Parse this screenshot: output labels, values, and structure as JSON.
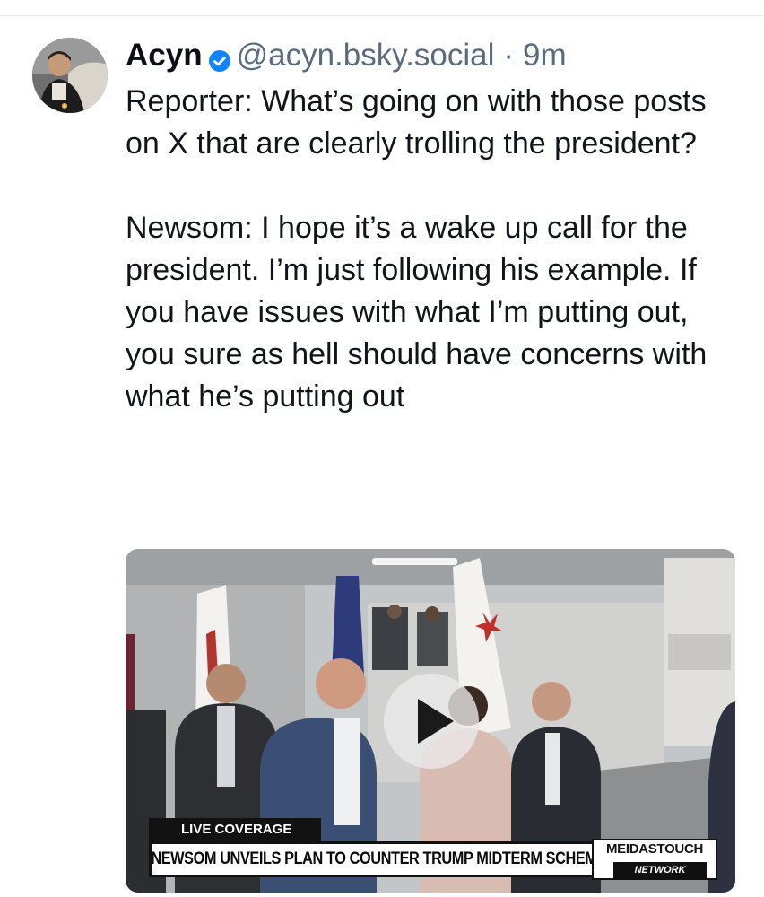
{
  "post": {
    "author_name": "Acyn",
    "verified_icon": "verified-badge-icon",
    "handle": "@acyn.bsky.social",
    "separator": "·",
    "time_ago": "9m",
    "paragraphs": [
      "Reporter: What’s going on with those posts on X that are clearly trolling the president?",
      "Newsom: I hope it’s a wake up call for the president. I’m just following his example. If you have issues with what I’m putting out, you sure as hell should have concerns with what he’s putting out"
    ]
  },
  "video": {
    "play_icon": "play-icon",
    "lower_third_label": "LIVE COVERAGE",
    "headline": "NEWSOM UNVEILS PLAN TO COUNTER TRUMP MIDTERM SCHEME",
    "brand_name": "MEIDASTOUCH",
    "brand_sub": "NETWORK"
  },
  "colors": {
    "verified_badge": "#1083fe",
    "handle_text": "#5b6b7e",
    "body_text": "#111418"
  }
}
